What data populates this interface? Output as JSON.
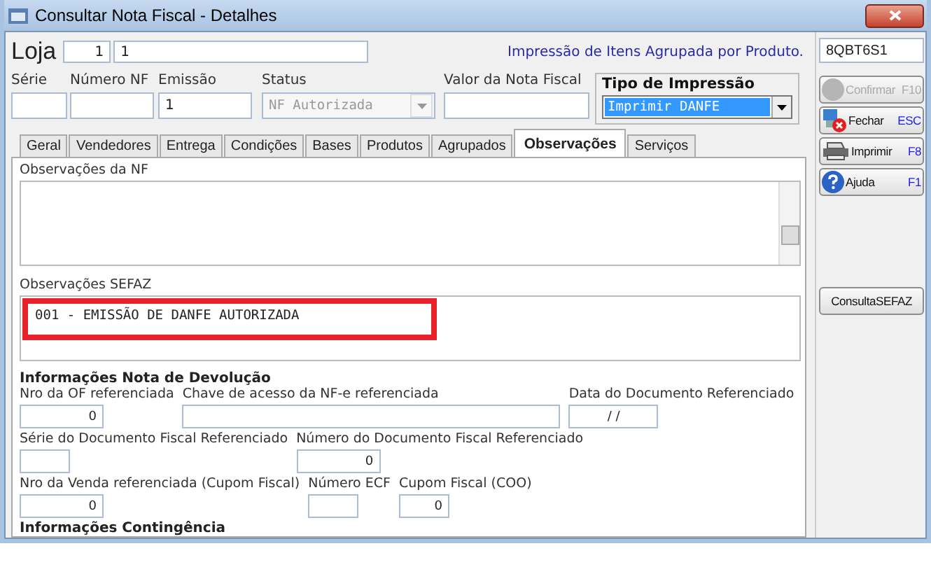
{
  "window": {
    "title": "Consultar Nota Fiscal - Detalhes"
  },
  "loja": {
    "label": "Loja",
    "code": "1",
    "name": "1"
  },
  "notice": "Impressão de Itens Agrupada por Produto.",
  "header_fields": [
    {
      "label": "Série",
      "kind": "input"
    },
    {
      "label": "Número NF",
      "kind": "input"
    },
    {
      "label": "Emissão",
      "value": "1",
      "kind": "input"
    },
    {
      "label": "Status",
      "value": "NF Autorizada",
      "kind": "select",
      "disabled": true
    },
    {
      "label": "Valor da Nota Fiscal",
      "kind": "input"
    }
  ],
  "tipo_impressao": {
    "label": "Tipo de Impressão",
    "value": "Imprimir DANFE"
  },
  "tabs": [
    {
      "label": "Geral",
      "selected": false
    },
    {
      "label": "Vendedores",
      "selected": false
    },
    {
      "label": "Entrega",
      "selected": false
    },
    {
      "label": "Condições",
      "selected": false
    },
    {
      "label": "Bases",
      "selected": false
    },
    {
      "label": "Produtos",
      "selected": false
    },
    {
      "label": "Agrupados",
      "selected": false
    },
    {
      "label": "Observações",
      "selected": true
    },
    {
      "label": "Serviços",
      "selected": false
    }
  ],
  "observacoes_nf": {
    "label": "Observações da NF"
  },
  "observacoes_sefaz": {
    "label": "Observações SEFAZ",
    "value": "001 - EMISSÃO DE DANFE AUTORIZADA",
    "highlighted": true
  },
  "devolucao": {
    "title": "Informações Nota de Devolução",
    "rows": [
      [
        {
          "label": "Nro da OF referenciada",
          "value": "0"
        },
        {
          "label": "Chave de acesso da NF-e referenciada"
        },
        {
          "label": "Data do Documento Referenciado",
          "value": "/   /"
        }
      ],
      [
        {
          "label": "Série do Documento Fiscal Referenciado"
        },
        {
          "label": "Número do Documento Fiscal Referenciado",
          "value": "0"
        }
      ],
      [
        {
          "label": "Nro da Venda referenciada (Cupom Fiscal)",
          "value": "0"
        },
        {
          "label": "Número ECF"
        },
        {
          "label": "Cupom Fiscal (COO)",
          "value": "0"
        }
      ]
    ]
  },
  "contingencia": {
    "title": "Informações Contingência"
  },
  "sidebar": {
    "code": "8QBT6S1",
    "buttons": [
      {
        "label": "Confirmar",
        "key": "F10",
        "kind": "confirm",
        "disabled": true
      },
      {
        "label": "Fechar",
        "key": "ESC",
        "kind": "close",
        "disabled": false
      },
      {
        "label": "Imprimir",
        "key": "F8",
        "kind": "print",
        "disabled": false
      },
      {
        "label": "Ajuda",
        "key": "F1",
        "kind": "help",
        "disabled": false
      }
    ],
    "sefaz_button": "ConsultaSEFAZ"
  }
}
